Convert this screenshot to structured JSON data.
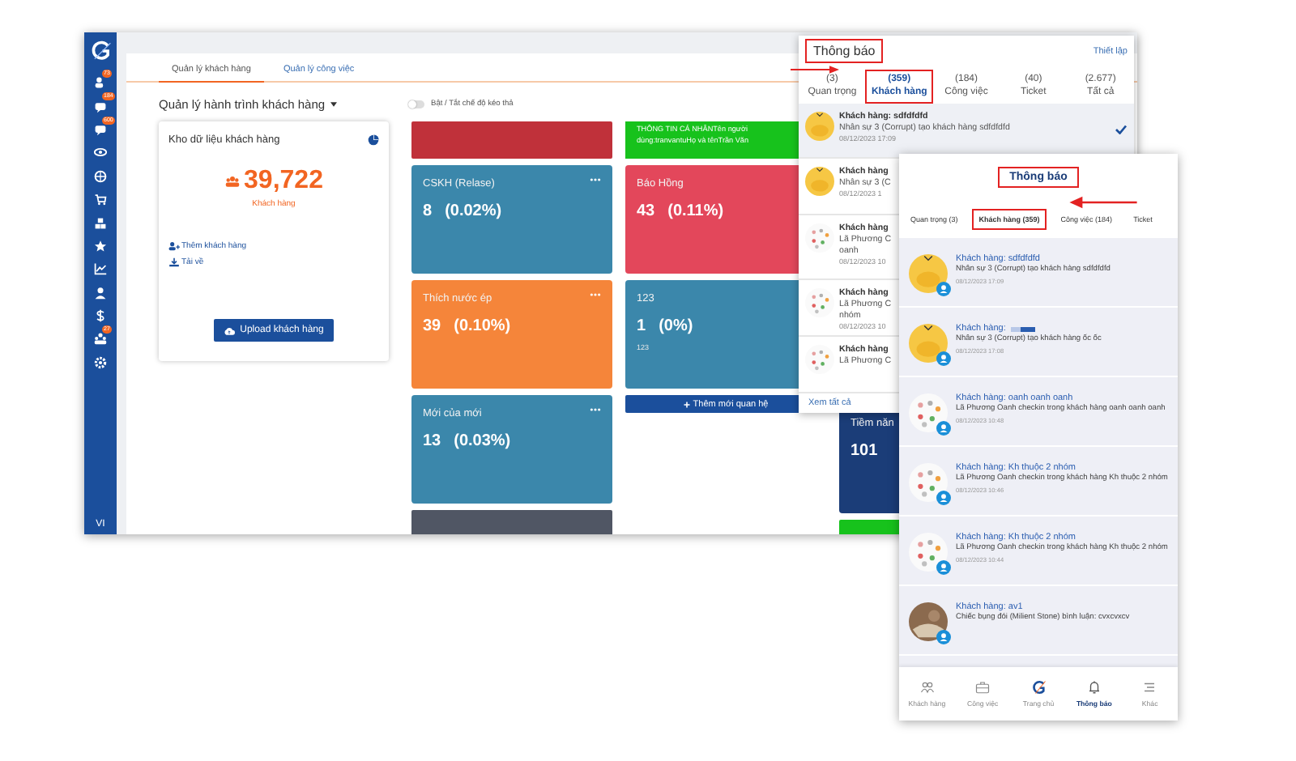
{
  "sidebar": {
    "items": [
      {
        "kind": "people",
        "badge": "73"
      },
      {
        "kind": "chat",
        "badge": "184"
      },
      {
        "kind": "chat",
        "badge": "600"
      },
      {
        "kind": "eye"
      },
      {
        "kind": "globe"
      },
      {
        "kind": "cart"
      },
      {
        "kind": "boxes"
      },
      {
        "kind": "star"
      },
      {
        "kind": "chart"
      },
      {
        "kind": "person"
      },
      {
        "kind": "dollar"
      },
      {
        "kind": "team",
        "badge": "27"
      },
      {
        "kind": "settings"
      }
    ],
    "language": "VI"
  },
  "workspace": {
    "tabs": [
      {
        "label": "Quản lý khách hàng",
        "selected": true
      },
      {
        "label": "Quản lý công việc",
        "selected": false
      }
    ],
    "journey_title": "Quản lý hành trình khách hàng",
    "toggle": {
      "label": "Bật / Tắt chế độ kéo thả",
      "on": false
    },
    "data_card": {
      "title": "Kho dữ liệu khách hàng",
      "count": "39,722",
      "count_label": "Khách hàng",
      "links": [
        "Thêm khách hàng",
        "Tải về"
      ],
      "button": "Upload khách hàng"
    },
    "columns": [
      {
        "cards": [
          {
            "kind": "strip",
            "color": "#c0313a"
          },
          {
            "kind": "stage",
            "color": "#3b87ab",
            "title": "CSKH (Relase)",
            "value": "8",
            "percent": "(0.02%)"
          },
          {
            "kind": "stage",
            "color": "#f5853a",
            "title": "Thích nước ép",
            "value": "39",
            "percent": "(0.10%)"
          },
          {
            "kind": "stage",
            "color": "#3b87ab",
            "title": "Mới của mới",
            "value": "13",
            "percent": "(0.03%)"
          },
          {
            "kind": "strip",
            "color": "#505664"
          }
        ]
      },
      {
        "cards": [
          {
            "kind": "note",
            "color": "#17c21c",
            "text": "THÔNG TIN CÁ NHÂNTên người dùng:tranvantuHọ và tênTrần Văn"
          },
          {
            "kind": "stage",
            "color": "#e3475b",
            "title": "Báo Hồng",
            "value": "43",
            "percent": "(0.11%)"
          },
          {
            "kind": "stage",
            "color": "#3b87ab",
            "title": "123",
            "value": "1",
            "percent": "(0%)",
            "sub": "123"
          },
          {
            "kind": "add",
            "label": "Thêm mới quan hệ"
          }
        ]
      },
      {
        "cards": [
          {
            "kind": "stage",
            "color": "#1b3d78",
            "title": "Tiềm năn",
            "value": "101"
          },
          {
            "kind": "strip",
            "color": "#17c21c"
          }
        ]
      }
    ]
  },
  "notification_dropdown": {
    "title": "Thông báo",
    "highlighted": true,
    "settings_link": "Thiết lập",
    "tabs": [
      {
        "count": "(3)",
        "label": "Quan trọng",
        "selected": false,
        "highlighted": false
      },
      {
        "count": "(359)",
        "label": "Khách hàng",
        "selected": true,
        "highlighted": true
      },
      {
        "count": "(184)",
        "label": "Công việc",
        "selected": false,
        "highlighted": false
      },
      {
        "count": "(40)",
        "label": "Ticket",
        "selected": false,
        "highlighted": false
      },
      {
        "count": "(2.677)",
        "label": "Tất cả",
        "selected": false,
        "highlighted": false
      }
    ],
    "items": [
      {
        "kind": "duck",
        "title": "Khách hàng: sdfdfdfd",
        "lines": [
          "Nhân sự 3 (Corrupt) tạo khách hàng sdfdfdfd"
        ],
        "time": "08/12/2023 17:09",
        "checked": true
      },
      {
        "kind": "duck",
        "title": "Khách hàng",
        "lines": [
          "Nhân sự 3 (C"
        ],
        "time": "08/12/2023 1",
        "checked": false
      },
      {
        "kind": "sticker",
        "title": "Khách hàng",
        "lines": [
          "Lã Phương C",
          "oanh"
        ],
        "time": "08/12/2023 10",
        "checked": false
      },
      {
        "kind": "sticker",
        "title": "Khách hàng",
        "lines": [
          "Lã Phương C",
          "nhóm"
        ],
        "time": "08/12/2023 10",
        "checked": false
      },
      {
        "kind": "sticker",
        "title": "Khách hàng",
        "lines": [
          "Lã Phương C"
        ],
        "checked": false
      }
    ],
    "footer_link": "Xem tất cả"
  },
  "mobile_notifications": {
    "title": "Thông báo",
    "highlighted": true,
    "tabs": [
      {
        "label": "Quan trọng (3)",
        "selected": false,
        "highlighted": false
      },
      {
        "label": "Khách hàng (359)",
        "selected": true,
        "highlighted": true
      },
      {
        "label": "Công việc (184)",
        "selected": false,
        "highlighted": false
      },
      {
        "label": "Ticket",
        "selected": false,
        "highlighted": false
      }
    ],
    "items": [
      {
        "kind": "duck",
        "title": "Khách hàng: sdfdfdfd",
        "text": "Nhân sự 3 (Corrupt) tạo khách hàng sdfdfdfd",
        "time": "08/12/2023 17:09"
      },
      {
        "kind": "duck",
        "title": "Khách hàng:",
        "redacted": true,
        "text": "Nhân sự 3 (Corrupt) tạo khách hàng ốc ốc",
        "time": "08/12/2023 17:08"
      },
      {
        "kind": "sticker",
        "title": "Khách hàng: oanh oanh oanh",
        "text": "Lã Phương Oanh checkin trong khách hàng oanh oanh oanh",
        "time": "08/12/2023 10:48"
      },
      {
        "kind": "sticker",
        "title": "Khách hàng: Kh thuộc 2 nhóm",
        "text": "Lã Phương Oanh checkin trong khách hàng Kh thuộc 2 nhóm",
        "time": "08/12/2023 10:46"
      },
      {
        "kind": "sticker",
        "title": "Khách hàng: Kh thuộc 2 nhóm",
        "text": "Lã Phương Oanh checkin trong khách hàng Kh thuộc 2 nhóm",
        "time": "08/12/2023 10:44"
      },
      {
        "kind": "photo",
        "title": "Khách hàng: av1",
        "text": "Chiếc bụng đói (Milient Stone) bình luận: cvxcvxcv"
      }
    ],
    "nav": [
      {
        "label": "Khách hàng",
        "selected": false
      },
      {
        "label": "Công việc",
        "selected": false
      },
      {
        "label": "Trang chủ",
        "selected": false
      },
      {
        "label": "Thông báo",
        "selected": true
      },
      {
        "label": "Khác",
        "selected": false
      }
    ]
  }
}
